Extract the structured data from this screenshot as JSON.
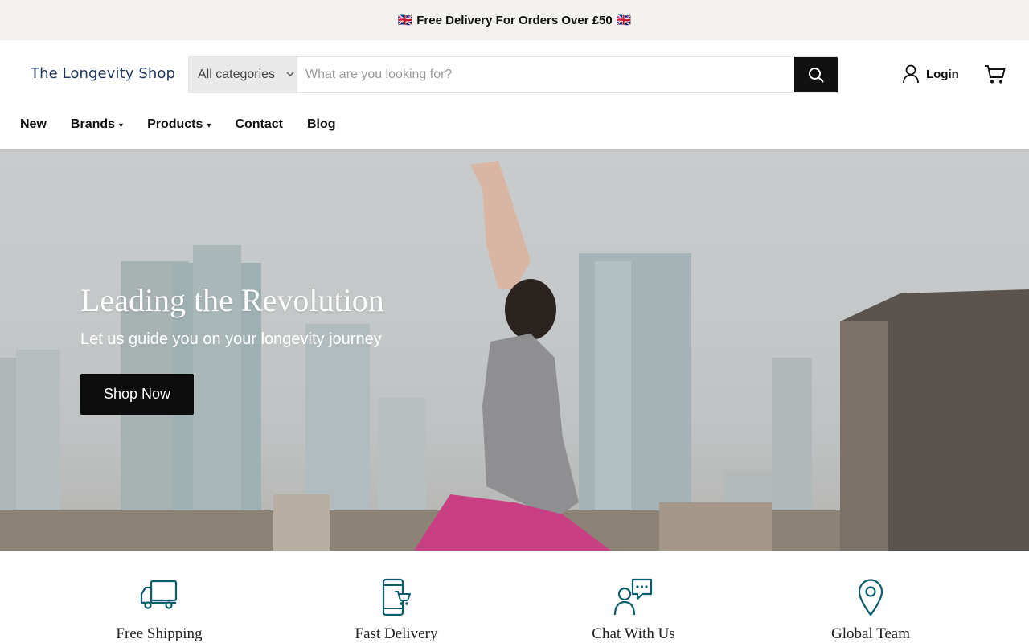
{
  "announcement": {
    "flag_left": "🇬🇧",
    "text": "Free Delivery For Orders Over £50",
    "flag_right": "🇬🇧"
  },
  "header": {
    "logo": "The Longevity Shop",
    "search": {
      "category": "All categories",
      "placeholder": "What are you looking for?",
      "value": ""
    },
    "login_label": "Login"
  },
  "nav": {
    "items": [
      {
        "label": "New"
      },
      {
        "label": "Brands"
      },
      {
        "label": "Products"
      },
      {
        "label": "Contact"
      },
      {
        "label": "Blog"
      }
    ]
  },
  "hero": {
    "title": "Leading the Revolution",
    "subtitle": "Let us guide you on your longevity journey",
    "cta": "Shop Now"
  },
  "features": [
    {
      "label": "Free Shipping",
      "icon": "truck-icon"
    },
    {
      "label": "Fast Delivery",
      "icon": "phone-cart-icon"
    },
    {
      "label": "Chat With Us",
      "icon": "chat-icon"
    },
    {
      "label": "Global Team",
      "icon": "map-pin-icon"
    }
  ],
  "colors": {
    "accent_icon": "#0b5d6b",
    "button": "#111111",
    "announcement_bg": "#f4f2ee",
    "logo": "#1f3559"
  }
}
